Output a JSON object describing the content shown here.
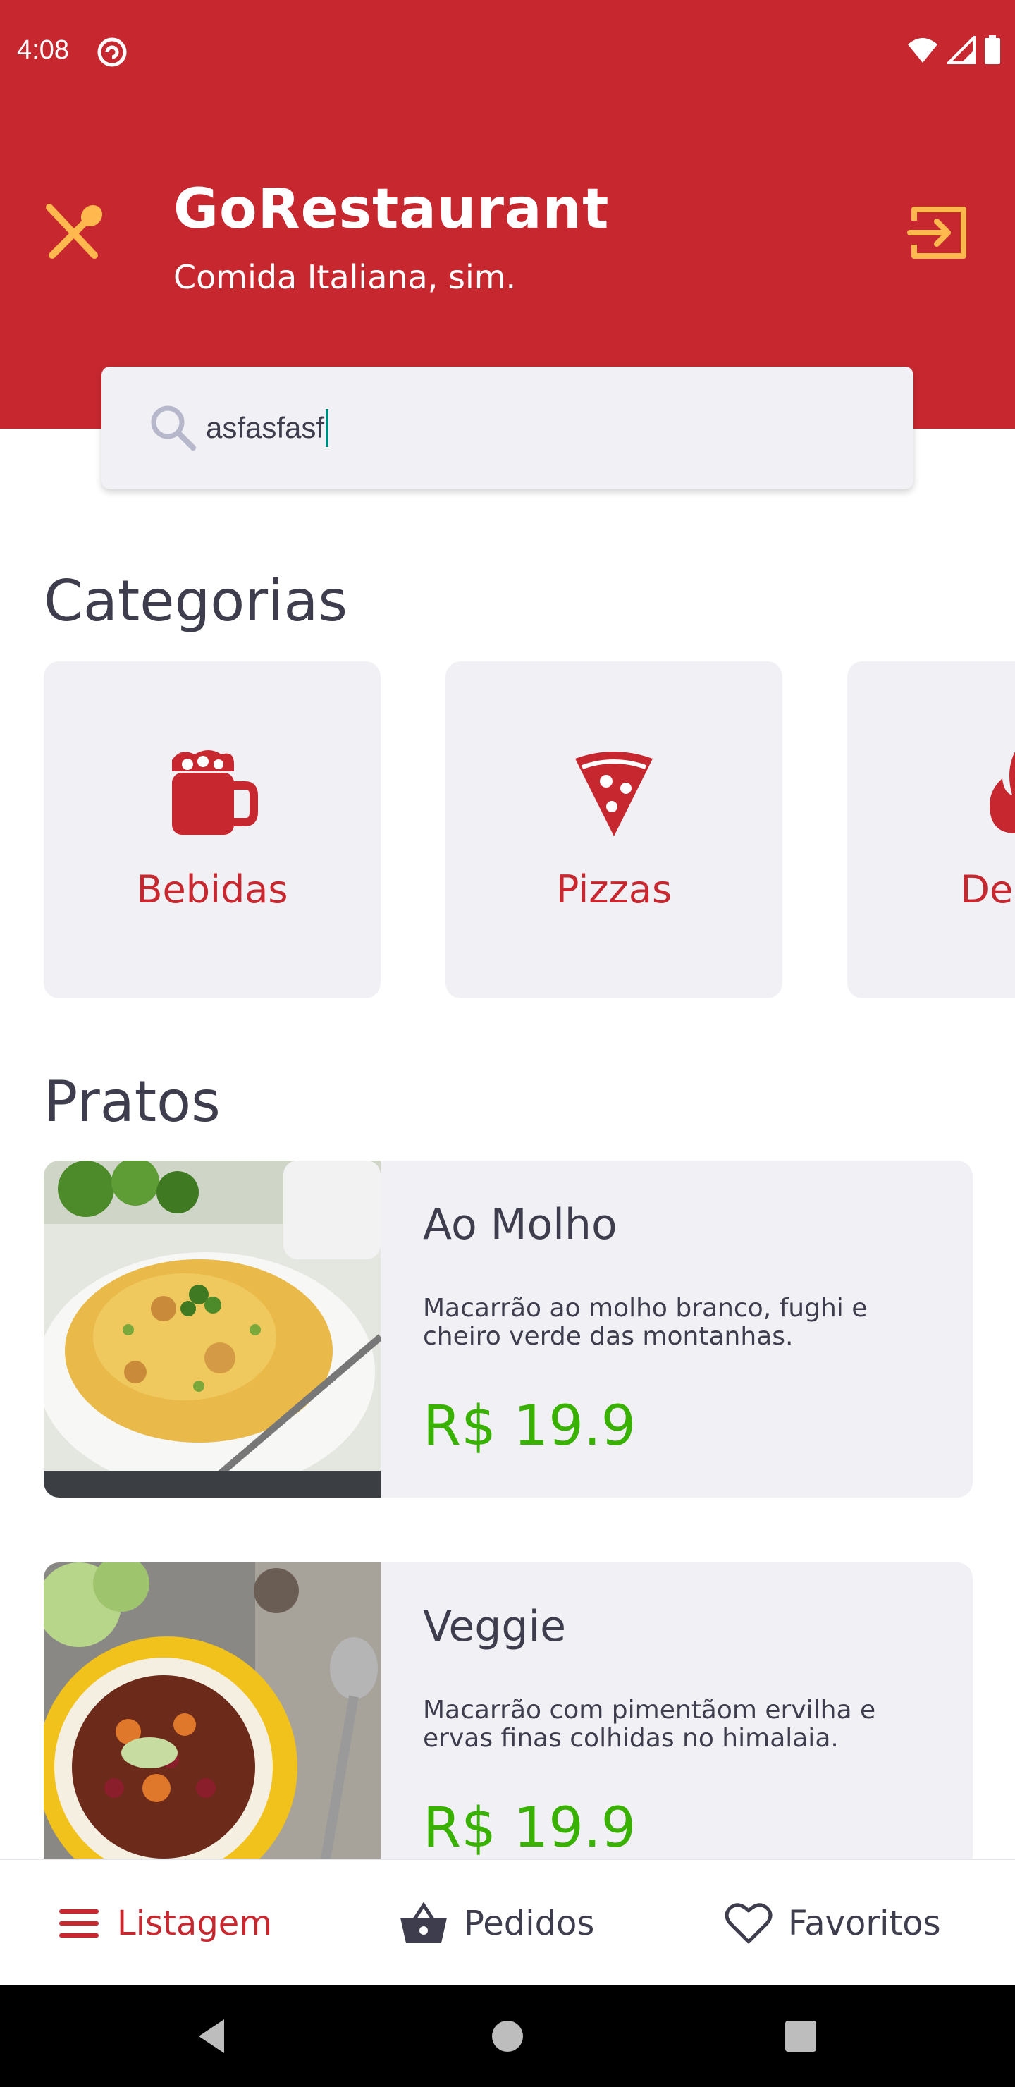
{
  "status_bar": {
    "time": "4:08"
  },
  "header": {
    "title": "GoRestaurant",
    "subtitle": "Comida Italiana, sim."
  },
  "search": {
    "value": "asfasfasf"
  },
  "categories": {
    "title": "Categorias",
    "items": [
      {
        "label": "Bebidas",
        "icon": "beer-mug-icon"
      },
      {
        "label": "Pizzas",
        "icon": "pizza-slice-icon"
      },
      {
        "label": "Desta",
        "icon": "fire-icon"
      }
    ]
  },
  "dishes": {
    "title": "Pratos",
    "items": [
      {
        "name": "Ao Molho",
        "description": "Macarrão ao molho branco, fughi e cheiro verde das montanhas.",
        "price": "R$ 19.9"
      },
      {
        "name": "Veggie",
        "description": "Macarrão com pimentãom ervilha e ervas finas colhidas no himalaia.",
        "price": "R$ 19.9"
      }
    ]
  },
  "bottom_nav": {
    "items": [
      {
        "label": "Listagem",
        "icon": "menu-icon",
        "active": true
      },
      {
        "label": "Pedidos",
        "icon": "basket-icon",
        "active": false
      },
      {
        "label": "Favoritos",
        "icon": "heart-icon",
        "active": false
      }
    ]
  },
  "colors": {
    "primary": "#c72830",
    "accent": "#ffb84d",
    "price": "#39b100",
    "card": "#f0f0f5",
    "text": "#3d3d4d"
  }
}
